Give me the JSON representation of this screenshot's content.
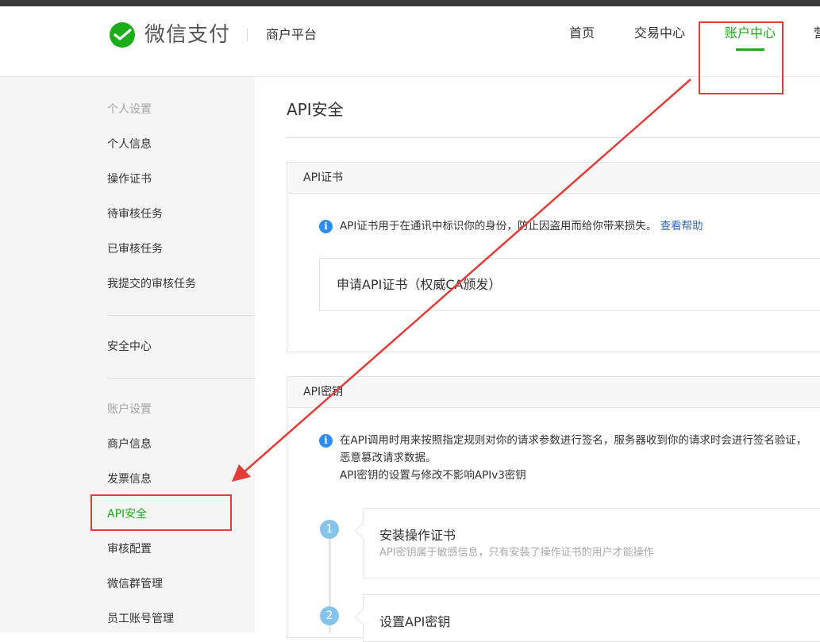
{
  "header": {
    "brand": "微信支付",
    "subbrand": "商户平台",
    "nav": [
      "首页",
      "交易中心",
      "账户中心",
      "营"
    ]
  },
  "sidebar": {
    "sections": [
      {
        "heading": "个人设置",
        "items": [
          "个人信息",
          "操作证书",
          "待审核任务",
          "已审核任务",
          "我提交的审核任务"
        ]
      },
      {
        "heading": "",
        "items": [
          "安全中心"
        ]
      },
      {
        "heading": "账户设置",
        "items": [
          "商户信息",
          "发票信息",
          "API安全",
          "审核配置",
          "微信群管理",
          "员工账号管理"
        ]
      }
    ],
    "active": "API安全"
  },
  "main": {
    "title": "API安全",
    "cert_panel": {
      "heading": "API证书",
      "info": "API证书用于在通讯中标识你的身份，防止因盗用而给你带来损失。",
      "help": "查看帮助",
      "apply": "申请API证书（权威CA颁发）"
    },
    "key_panel": {
      "heading": "API密钥",
      "info_line1": "在API调用时用来按照指定规则对你的请求参数进行签名，服务器收到你的请求时会进行签名验证，",
      "info_line2": "恶意篡改请求数据。",
      "info_line3": "API密钥的设置与修改不影响APIv3密钥",
      "steps": [
        {
          "num": "1",
          "title": "安装操作证书",
          "desc": "API密钥属于敏感信息，只有安装了操作证书的用户才能操作"
        },
        {
          "num": "2",
          "title": "设置API密钥",
          "desc": ""
        }
      ]
    }
  },
  "colors": {
    "accent": "#1aad19",
    "highlight": "#e53c37",
    "link": "#2e6ab1",
    "info": "#2d8cf0"
  },
  "icons": {
    "logo": "wechat-pay-logo",
    "info": "info-icon"
  }
}
